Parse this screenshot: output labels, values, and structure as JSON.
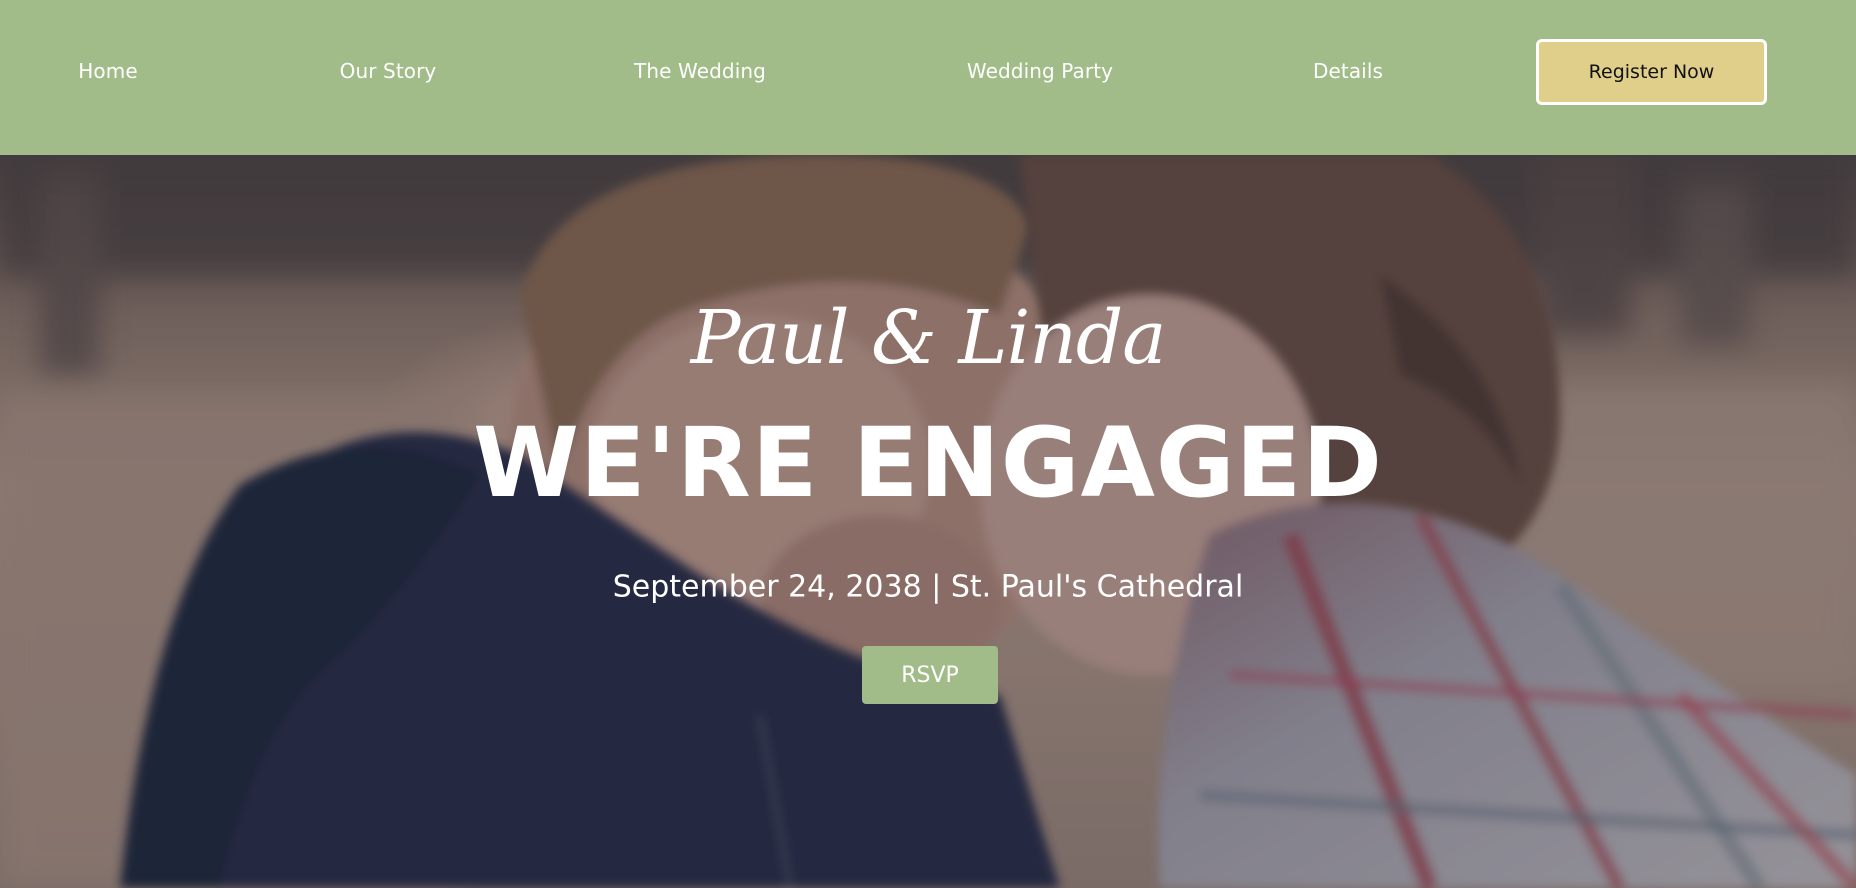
{
  "nav": {
    "items": [
      {
        "label": "Home"
      },
      {
        "label": "Our Story"
      },
      {
        "label": "The Wedding"
      },
      {
        "label": "Wedding Party"
      },
      {
        "label": "Details"
      }
    ],
    "register_label": "Register Now"
  },
  "hero": {
    "names": "Paul & Linda",
    "heading": "WE'RE ENGAGED",
    "event_line": "September 24, 2038 | St. Paul's Cathedral",
    "rsvp_label": "RSVP",
    "image": "engaged-couple-photo"
  },
  "colors": {
    "accent_green": "#a1bc88",
    "register_gold": "#dfcf8a",
    "text_white": "#ffffff"
  }
}
